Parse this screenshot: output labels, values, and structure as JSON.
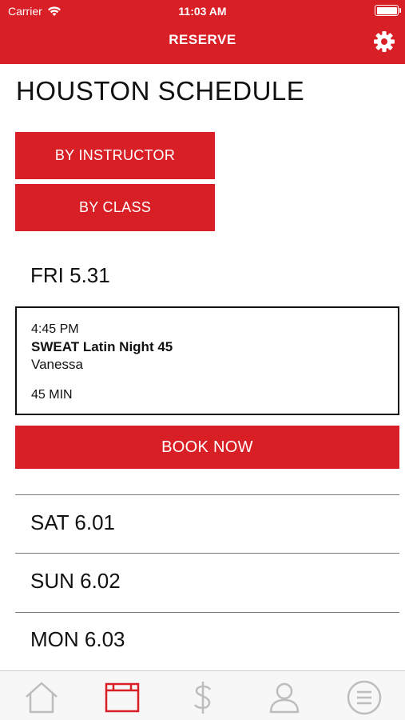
{
  "status_bar": {
    "carrier": "Carrier",
    "time": "11:03 AM"
  },
  "nav": {
    "title": "RESERVE",
    "settings_icon": "gear-icon"
  },
  "page": {
    "title": "HOUSTON SCHEDULE"
  },
  "filters": {
    "by_instructor": "BY INSTRUCTOR",
    "by_class": "BY CLASS"
  },
  "schedule": {
    "days": [
      {
        "label": "FRI 5.31",
        "expanded": true
      },
      {
        "label": "SAT 6.01",
        "expanded": false
      },
      {
        "label": "SUN 6.02",
        "expanded": false
      },
      {
        "label": "MON 6.03",
        "expanded": false
      }
    ],
    "class_card": {
      "time": "4:45 PM",
      "class_name": "SWEAT Latin Night 45",
      "instructor": "Vanessa",
      "duration": "45 MIN"
    },
    "book_label": "BOOK NOW"
  },
  "tabbar": {
    "items": [
      {
        "icon": "home-icon",
        "active": false
      },
      {
        "icon": "calendar-icon",
        "active": true
      },
      {
        "icon": "dollar-icon",
        "active": false
      },
      {
        "icon": "profile-icon",
        "active": false
      },
      {
        "icon": "menu-icon",
        "active": false
      }
    ]
  },
  "colors": {
    "brand_red": "#d91f26",
    "tab_inactive": "#bdbdbd"
  }
}
